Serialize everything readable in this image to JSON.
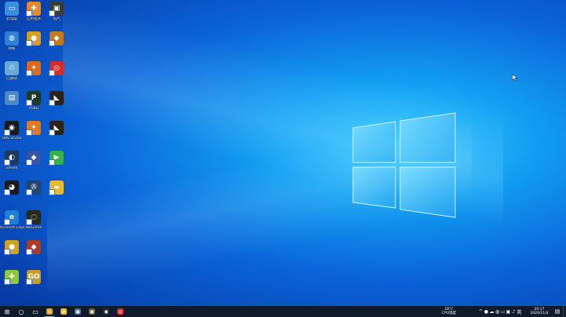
{
  "desktop": {
    "icons": [
      {
        "id": "this-pc",
        "label": "此电脑",
        "color": "#3b8de0",
        "glyph": "▭",
        "col": 0,
        "row": 0,
        "sys": true
      },
      {
        "id": "app-yellow",
        "label": "应用程序",
        "color": "#e08a2c",
        "glyph": "✚",
        "col": 1,
        "row": 0
      },
      {
        "id": "app-photo",
        "label": "照片",
        "color": "#3a3a3a",
        "glyph": "▣",
        "col": 2,
        "row": 0
      },
      {
        "id": "network",
        "label": "网络",
        "color": "#2f7fd6",
        "glyph": "◍",
        "col": 0,
        "row": 1,
        "sys": true
      },
      {
        "id": "app-bear",
        "label": "",
        "color": "#d8a020",
        "glyph": "●",
        "col": 1,
        "row": 1
      },
      {
        "id": "app-game",
        "label": "",
        "color": "#c47a18",
        "glyph": "◆",
        "col": 2,
        "row": 1
      },
      {
        "id": "recycle-bin",
        "label": "回收站",
        "color": "#6aa8d8",
        "glyph": "♲",
        "col": 0,
        "row": 2,
        "sys": true
      },
      {
        "id": "app-orange",
        "label": "",
        "color": "#e06a1c",
        "glyph": "✦",
        "col": 1,
        "row": 2
      },
      {
        "id": "netease-music",
        "label": "",
        "color": "#d62a2a",
        "glyph": "◎",
        "col": 2,
        "row": 2
      },
      {
        "id": "control-panel",
        "label": "",
        "color": "#4a88c8",
        "glyph": "▤",
        "col": 0,
        "row": 3,
        "sys": true
      },
      {
        "id": "pubg",
        "label": "PUBG",
        "color": "#1f3a22",
        "glyph": "P",
        "col": 1,
        "row": 3
      },
      {
        "id": "app-dark",
        "label": "",
        "color": "#2a2418",
        "glyph": "◣",
        "col": 2,
        "row": 3
      },
      {
        "id": "obs-studio",
        "label": "OBS Studio",
        "color": "#1a1a1a",
        "glyph": "◉",
        "col": 0,
        "row": 4
      },
      {
        "id": "app-orange2",
        "label": "",
        "color": "#e07a20",
        "glyph": "✦",
        "col": 1,
        "row": 4
      },
      {
        "id": "app-dark2",
        "label": "",
        "color": "#2a2418",
        "glyph": "◣",
        "col": 2,
        "row": 4
      },
      {
        "id": "steam",
        "label": "Steam",
        "color": "#1b3a5c",
        "glyph": "◐",
        "col": 0,
        "row": 5
      },
      {
        "id": "app-blue",
        "label": "",
        "color": "#3654a8",
        "glyph": "◆",
        "col": 1,
        "row": 5
      },
      {
        "id": "tencent-video",
        "label": "",
        "color": "#33b24a",
        "glyph": "▶",
        "col": 2,
        "row": 5
      },
      {
        "id": "qq",
        "label": "",
        "color": "#1a1a1a",
        "glyph": "◕",
        "col": 0,
        "row": 6
      },
      {
        "id": "app-compass",
        "label": "",
        "color": "#24466e",
        "glyph": "✇",
        "col": 1,
        "row": 6
      },
      {
        "id": "folder",
        "label": "",
        "color": "#e8b830",
        "glyph": "▰",
        "col": 2,
        "row": 6
      },
      {
        "id": "edge",
        "label": "Microsoft Edge",
        "color": "#1f7fd8",
        "glyph": "e",
        "col": 0,
        "row": 7
      },
      {
        "id": "wegame",
        "label": "WeGame",
        "color": "#2a2a1a",
        "glyph": "◌",
        "col": 1,
        "row": 7
      },
      {
        "id": "app-bear2",
        "label": "",
        "color": "#d8a020",
        "glyph": "●",
        "col": 0,
        "row": 8
      },
      {
        "id": "app-red",
        "label": "",
        "color": "#b03a2a",
        "glyph": "◆",
        "col": 1,
        "row": 8
      },
      {
        "id": "app-green",
        "label": "",
        "color": "#8cc83a",
        "glyph": "✚",
        "col": 0,
        "row": 9
      },
      {
        "id": "csgo",
        "label": "",
        "color": "#c89a28",
        "glyph": "GO",
        "col": 1,
        "row": 9
      }
    ]
  },
  "taskbar": {
    "start_glyph": "⊞",
    "search_glyph": "○",
    "taskview_glyph": "▭",
    "apps": [
      {
        "id": "app-g",
        "glyph": "G",
        "color": "#e0a020",
        "active": true
      },
      {
        "id": "app-explorer",
        "glyph": "▰",
        "color": "#e8b830",
        "active": false
      },
      {
        "id": "app-thumb1",
        "glyph": "▣",
        "color": "#4a6a8a",
        "active": false
      },
      {
        "id": "app-thumb2",
        "glyph": "▣",
        "color": "#6a5a2a",
        "active": false
      },
      {
        "id": "app-obs",
        "glyph": "◉",
        "color": "#2a2a2a",
        "active": false
      },
      {
        "id": "app-netease",
        "glyph": "◎",
        "color": "#d62a2a",
        "active": false
      }
    ],
    "tray": {
      "weather_temp": "18°C",
      "weather_desc": "CPU温度",
      "icons": [
        "^",
        "●",
        "☁",
        "◍",
        "▭",
        "▣",
        "♪",
        "英"
      ],
      "time": "20:17",
      "date": "2020/11/4",
      "notif_glyph": "▤"
    }
  }
}
